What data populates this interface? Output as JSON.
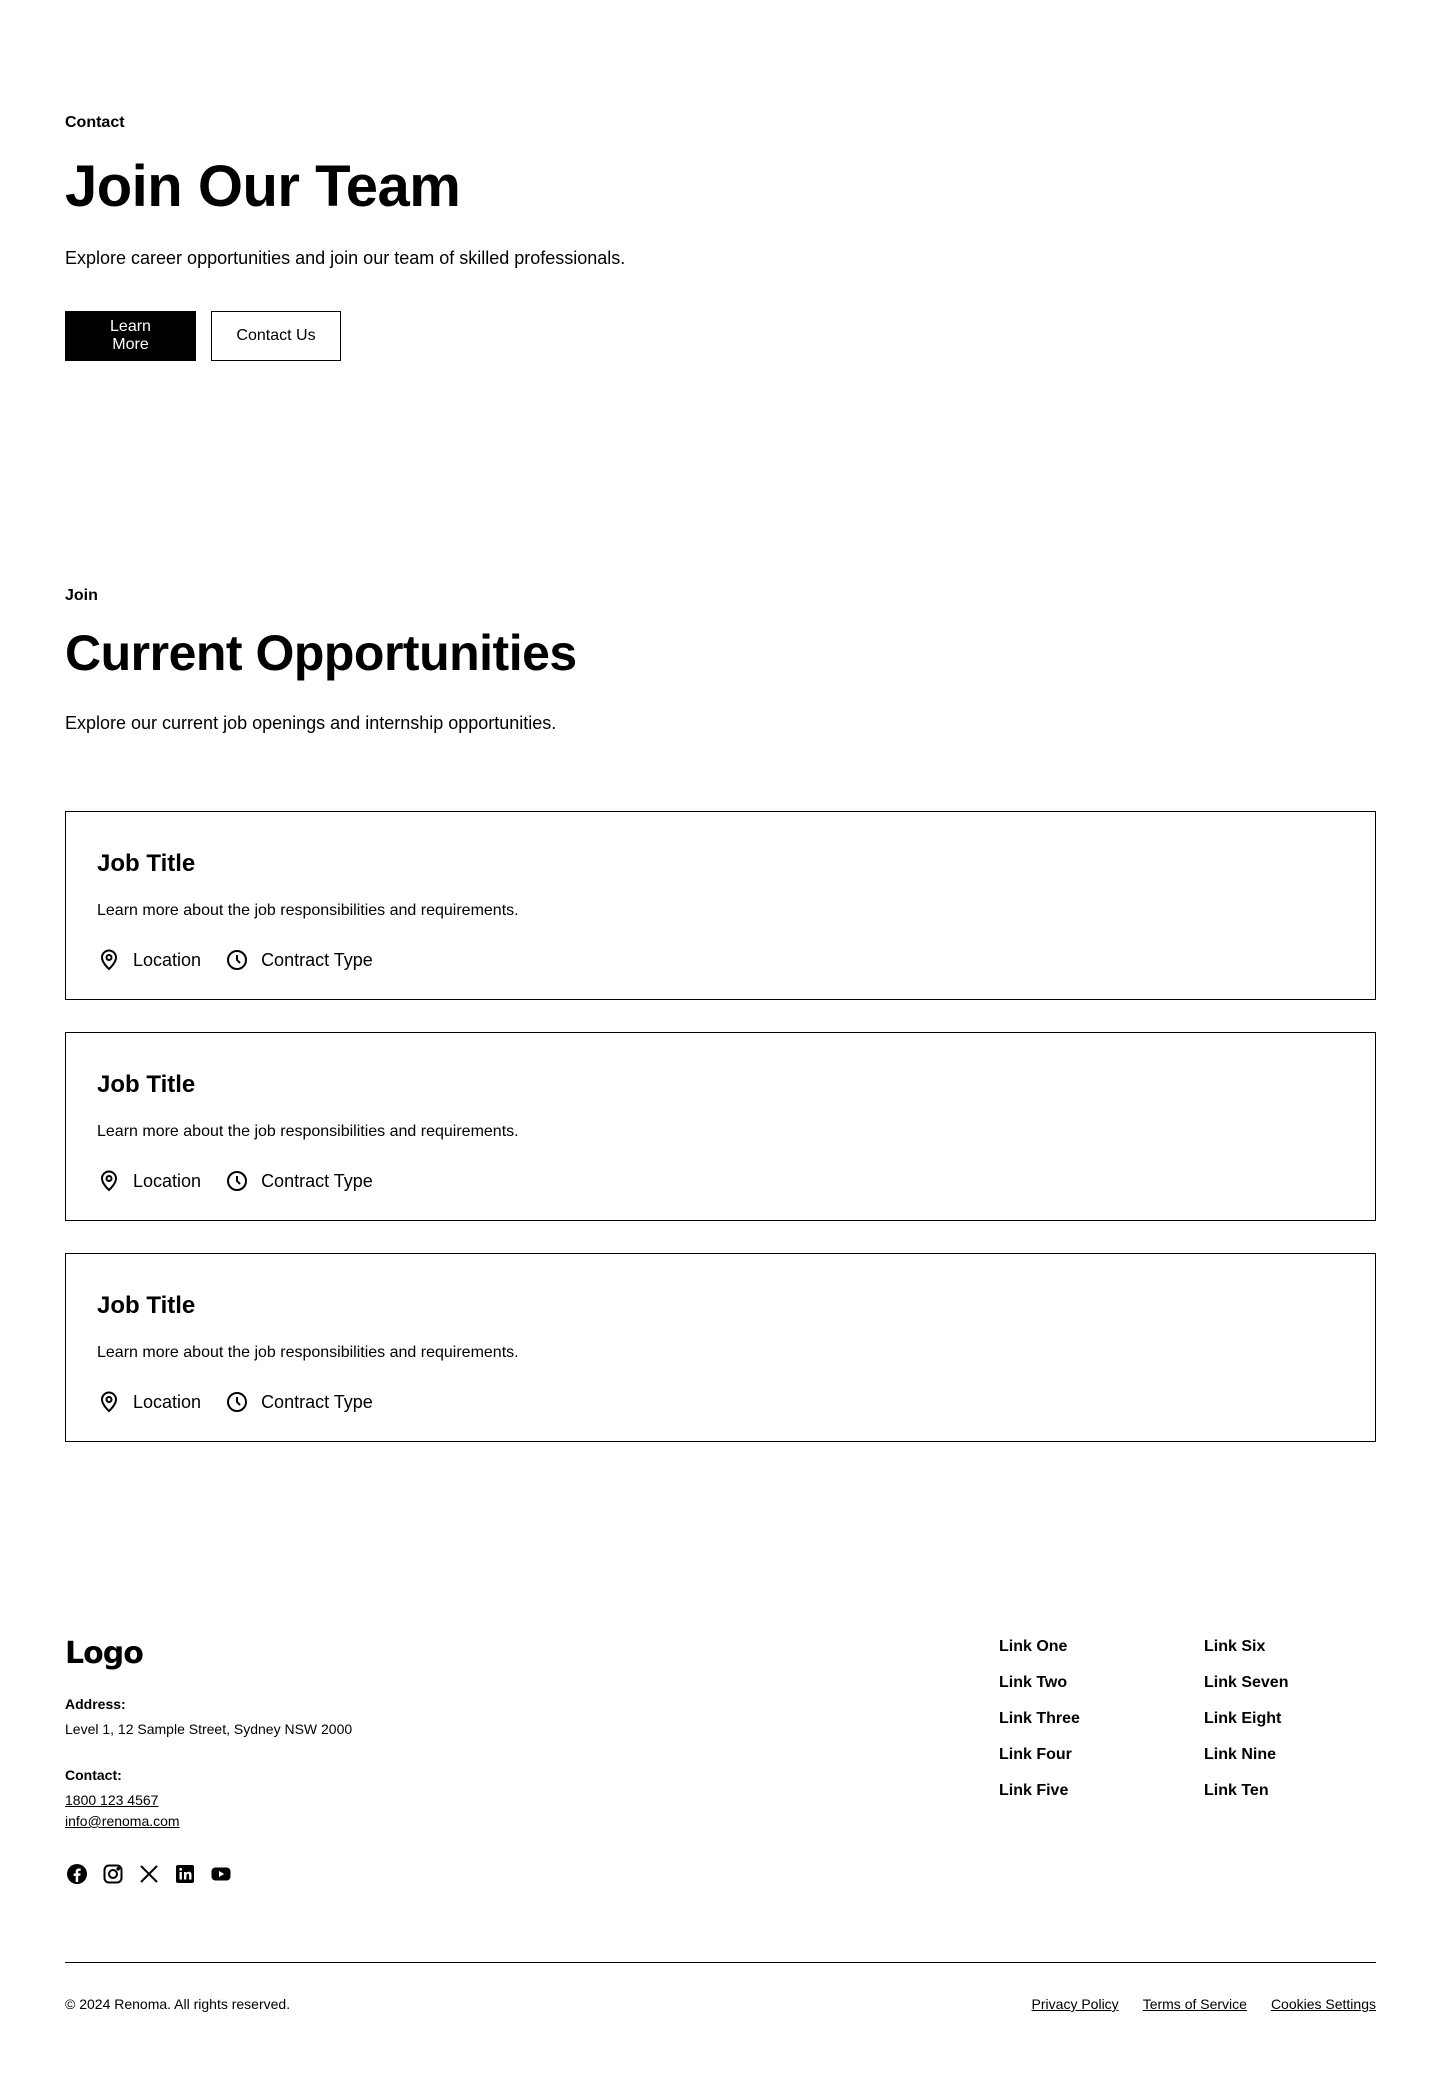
{
  "hero": {
    "eyebrow": "Contact",
    "title": "Join Our Team",
    "subtitle": "Explore career opportunities and join our team of skilled professionals.",
    "primary_button": "Learn More",
    "secondary_button": "Contact Us"
  },
  "opportunities": {
    "eyebrow": "Join",
    "title": "Current Opportunities",
    "subtitle": "Explore our current job openings and internship opportunities.",
    "jobs": [
      {
        "title": "Job Title",
        "description": "Learn more about the job responsibilities and requirements.",
        "location": "Location",
        "contract": "Contract Type"
      },
      {
        "title": "Job Title",
        "description": "Learn more about the job responsibilities and requirements.",
        "location": "Location",
        "contract": "Contract Type"
      },
      {
        "title": "Job Title",
        "description": "Learn more about the job responsibilities and requirements.",
        "location": "Location",
        "contract": "Contract Type"
      }
    ]
  },
  "footer": {
    "logo": "Logo",
    "address_label": "Address:",
    "address": "Level 1, 12 Sample Street, Sydney NSW 2000",
    "contact_label": "Contact:",
    "phone": "1800 123 4567",
    "email": "info@renoma.com",
    "social_icons": [
      "facebook-icon",
      "instagram-icon",
      "x-icon",
      "linkedin-icon",
      "youtube-icon"
    ],
    "links_col1": [
      "Link One",
      "Link Two",
      "Link Three",
      "Link Four",
      "Link Five"
    ],
    "links_col2": [
      "Link Six",
      "Link Seven",
      "Link Eight",
      "Link Nine",
      "Link Ten"
    ],
    "copyright": "© 2024 Renoma. All rights reserved.",
    "legal": [
      "Privacy Policy",
      "Terms of Service",
      "Cookies Settings"
    ]
  }
}
